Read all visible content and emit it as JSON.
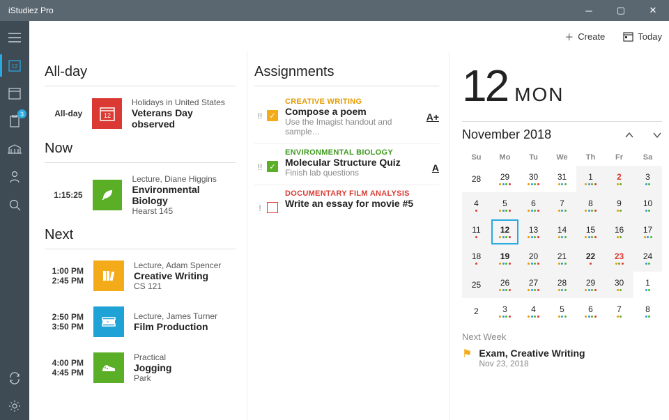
{
  "window": {
    "title": "iStudiez Pro"
  },
  "sidebar": {
    "badge": "3"
  },
  "topbar": {
    "create": "Create",
    "today": "Today"
  },
  "col1": {
    "allday_heading": "All-day",
    "now_heading": "Now",
    "next_heading": "Next",
    "allday": {
      "time": "All-day",
      "line1": "Holidays in United States",
      "line2": "Veterans Day observed",
      "icon_text": "12"
    },
    "now": {
      "time": "1:15:25",
      "line1": "Lecture, Diane Higgins",
      "line2": "Environmental Biology",
      "line3": "Hearst 145"
    },
    "next": [
      {
        "t1": "1:00 PM",
        "t2": "2:45 PM",
        "line1": "Lecture, Adam Spencer",
        "line2": "Creative Writing",
        "line3": "CS 121",
        "color": "amber",
        "icon": "books"
      },
      {
        "t1": "2:50 PM",
        "t2": "3:50 PM",
        "line1": "Lecture, James Turner",
        "line2": "Film Production",
        "line3": "",
        "color": "cyan",
        "icon": "film"
      },
      {
        "t1": "4:00 PM",
        "t2": "4:45 PM",
        "line1": "Practical",
        "line2": "Jogging",
        "line3": "Park",
        "color": "green",
        "icon": "shoe"
      }
    ]
  },
  "col2": {
    "heading": "Assignments",
    "items": [
      {
        "priority": "!!",
        "checked": true,
        "color": "amber",
        "course": "CREATIVE WRITING",
        "title": "Compose a poem",
        "desc": "Use the Imagist handout and sample…",
        "grade": "A+"
      },
      {
        "priority": "!!",
        "checked": true,
        "color": "green",
        "course": "ENVIRONMENTAL BIOLOGY",
        "title": "Molecular Structure Quiz",
        "desc": "Finish lab questions",
        "grade": "A"
      },
      {
        "priority": "!",
        "checked": false,
        "color": "red",
        "course": "DOCUMENTARY FILM ANALYSIS",
        "title": "Write an essay for movie #5",
        "desc": "",
        "grade": ""
      }
    ]
  },
  "col3": {
    "bignum": "12",
    "bigwd": "MON",
    "month": "November 2018",
    "dow": [
      "Su",
      "Mo",
      "Tu",
      "We",
      "Th",
      "Fr",
      "Sa"
    ],
    "weeks": [
      [
        {
          "n": "28"
        },
        {
          "n": "29",
          "d": [
            "o",
            "b",
            "g",
            "r"
          ]
        },
        {
          "n": "30",
          "d": [
            "o",
            "b",
            "g",
            "r"
          ]
        },
        {
          "n": "31",
          "d": [
            "o",
            "b",
            "g"
          ]
        },
        {
          "n": "1",
          "d": [
            "o",
            "b",
            "g",
            "r"
          ],
          "s": 1
        },
        {
          "n": "2",
          "d": [
            "o",
            "g"
          ],
          "s": 1,
          "red": 1
        },
        {
          "n": "3",
          "d": [
            "b",
            "g"
          ],
          "s": 1
        }
      ],
      [
        {
          "n": "4",
          "d": [
            "r"
          ],
          "s": 1
        },
        {
          "n": "5",
          "d": [
            "o",
            "b",
            "g",
            "r"
          ],
          "s": 1
        },
        {
          "n": "6",
          "d": [
            "o",
            "b",
            "g",
            "r"
          ],
          "s": 1
        },
        {
          "n": "7",
          "d": [
            "o",
            "b",
            "g"
          ],
          "s": 1
        },
        {
          "n": "8",
          "d": [
            "o",
            "b",
            "g",
            "r"
          ],
          "s": 1
        },
        {
          "n": "9",
          "d": [
            "o",
            "g"
          ],
          "s": 1
        },
        {
          "n": "10",
          "d": [
            "b",
            "g"
          ],
          "s": 1
        }
      ],
      [
        {
          "n": "11",
          "d": [
            "r"
          ],
          "s": 1
        },
        {
          "n": "12",
          "d": [
            "o",
            "b",
            "g",
            "r"
          ],
          "s": 1,
          "today": 1,
          "bold": 1
        },
        {
          "n": "13",
          "d": [
            "o",
            "b",
            "g",
            "r"
          ],
          "s": 1
        },
        {
          "n": "14",
          "d": [
            "o",
            "b",
            "g"
          ],
          "s": 1
        },
        {
          "n": "15",
          "d": [
            "o",
            "b",
            "g",
            "r"
          ],
          "s": 1
        },
        {
          "n": "16",
          "d": [
            "o",
            "g"
          ],
          "s": 1
        },
        {
          "n": "17",
          "d": [
            "o",
            "b",
            "g"
          ],
          "s": 1
        }
      ],
      [
        {
          "n": "18",
          "d": [
            "r"
          ],
          "s": 1
        },
        {
          "n": "19",
          "d": [
            "o",
            "b",
            "g",
            "r"
          ],
          "s": 1,
          "bold": 1
        },
        {
          "n": "20",
          "d": [
            "o",
            "b",
            "g",
            "r"
          ],
          "s": 1
        },
        {
          "n": "21",
          "d": [
            "o",
            "b",
            "g"
          ],
          "s": 1
        },
        {
          "n": "22",
          "d": [
            "r"
          ],
          "s": 1,
          "bold": 1
        },
        {
          "n": "23",
          "d": [
            "o",
            "g",
            "r"
          ],
          "s": 1,
          "red": 1
        },
        {
          "n": "24",
          "d": [
            "b",
            "g"
          ],
          "s": 1
        }
      ],
      [
        {
          "n": "25",
          "s": 1
        },
        {
          "n": "26",
          "d": [
            "o",
            "b",
            "g",
            "r"
          ],
          "s": 1
        },
        {
          "n": "27",
          "d": [
            "o",
            "b",
            "g",
            "r"
          ],
          "s": 1
        },
        {
          "n": "28",
          "d": [
            "o",
            "b",
            "g"
          ],
          "s": 1
        },
        {
          "n": "29",
          "d": [
            "o",
            "b",
            "g",
            "r"
          ],
          "s": 1
        },
        {
          "n": "30",
          "d": [
            "o",
            "g"
          ],
          "s": 1
        },
        {
          "n": "1",
          "d": [
            "b",
            "g"
          ]
        }
      ],
      [
        {
          "n": "2"
        },
        {
          "n": "3",
          "d": [
            "o",
            "b",
            "g",
            "r"
          ]
        },
        {
          "n": "4",
          "d": [
            "o",
            "b",
            "g",
            "r"
          ]
        },
        {
          "n": "5",
          "d": [
            "o",
            "b",
            "g"
          ]
        },
        {
          "n": "6",
          "d": [
            "o",
            "b",
            "g",
            "r"
          ]
        },
        {
          "n": "7",
          "d": [
            "o",
            "g"
          ]
        },
        {
          "n": "8",
          "d": [
            "b",
            "g"
          ]
        }
      ]
    ],
    "nextweek_heading": "Next Week",
    "nw": {
      "title": "Exam, Creative Writing",
      "date": "Nov 23, 2018"
    }
  }
}
